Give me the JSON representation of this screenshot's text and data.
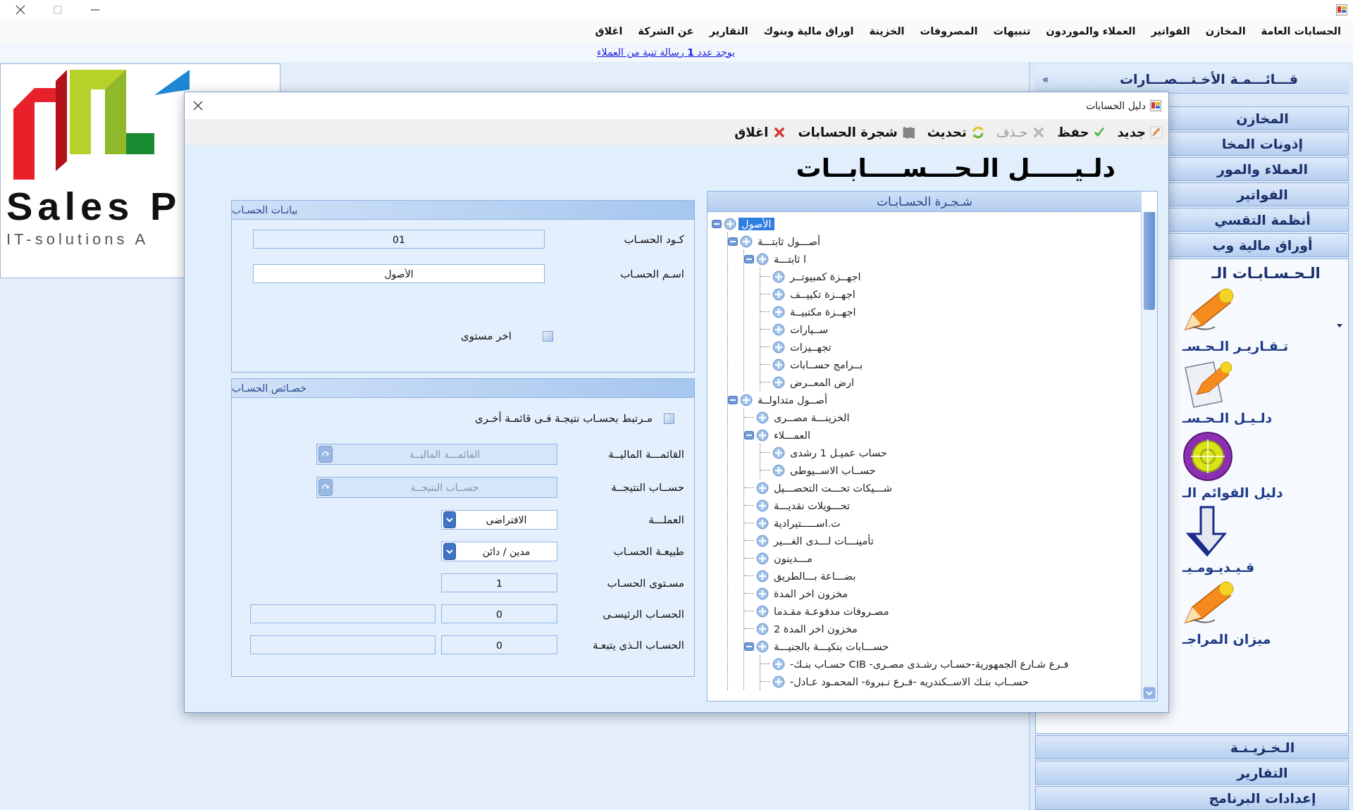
{
  "menu": [
    {
      "label": "الحسابات العامة"
    },
    {
      "label": "المخازن"
    },
    {
      "label": "الفواتير"
    },
    {
      "label": "العملاء والموردون"
    },
    {
      "label": "تنبيهات"
    },
    {
      "label": "المصروفات"
    },
    {
      "label": "الخزينة"
    },
    {
      "label": "اوراق مالية وبنوك"
    },
    {
      "label": "التقارير"
    },
    {
      "label": "عن الشركة"
    },
    {
      "label": "اغلاق"
    }
  ],
  "notice": "يوجد عدد  **1**  رسالة تنبة من العملاء",
  "logo": {
    "name": "Sales P",
    "tagline": "IT-solutions A"
  },
  "shortcuts": {
    "title": "قـــائـــمـة الأخـتـــصـــارات",
    "collapse": "»",
    "groups_top": [
      {
        "label": "المخازن"
      },
      {
        "label": "إذونات المخا"
      },
      {
        "label": "العملاء والمور"
      },
      {
        "label": "الفواتير"
      },
      {
        "label": "أنظمة التقسي"
      },
      {
        "label": "أوراق مالية وب"
      }
    ],
    "open_group": {
      "title": "الـحـسـابـات الـ",
      "items": [
        {
          "kind": "pencil",
          "label": "تـقـاريـر الـحـسـ"
        },
        {
          "kind": "document",
          "label": "دلـيـل الـحـسـ"
        },
        {
          "kind": "target",
          "label": "دليل القوائم الـ"
        },
        {
          "kind": "arrow",
          "label": "قـيـديـومـيـ"
        },
        {
          "kind": "pencil",
          "label": "ميزان المراجـ"
        }
      ]
    },
    "groups_bottom": [
      {
        "label": "الـخـزيـنـة"
      },
      {
        "label": "التقارير"
      },
      {
        "label": "إعدادات البرنامج"
      }
    ]
  },
  "dialog": {
    "title": "دليل الحسابات",
    "toolbar": [
      {
        "kind": "new",
        "label": "جديد",
        "disabled": false
      },
      {
        "kind": "save",
        "label": "حفظ",
        "disabled": false
      },
      {
        "kind": "delete",
        "label": "حـذف",
        "disabled": true
      },
      {
        "kind": "refresh",
        "label": "تحديث",
        "disabled": false
      },
      {
        "kind": "tree",
        "label": "شجرة الحسابات",
        "disabled": false
      },
      {
        "kind": "close",
        "label": "اغلاق",
        "disabled": false
      }
    ],
    "heading": "دلـيـــــل الـحـــســــابــات",
    "tree": {
      "title": "شـجـرة الحسـابـات",
      "nodes": [
        {
          "label": "الأصول",
          "selected": true,
          "expanded": true,
          "children": [
            {
              "label": "أصـــول ثابتـــة",
              "selected": false,
              "expanded": true,
              "children": [
                {
                  "label": "ا ثابتـــة",
                  "selected": false,
                  "expanded": true,
                  "children": [
                    {
                      "label": "اجهــزة كمبيوتــر",
                      "selected": false
                    },
                    {
                      "label": "اجهــزة تكييــف",
                      "selected": false
                    },
                    {
                      "label": "اجهــزة مكتبيــة",
                      "selected": false
                    },
                    {
                      "label": "ســيارات",
                      "selected": false
                    },
                    {
                      "label": "تجهــيزات",
                      "selected": false
                    },
                    {
                      "label": "بــرامج حســابات",
                      "selected": false
                    },
                    {
                      "label": "ارض المعــرض",
                      "selected": false
                    }
                  ]
                }
              ]
            },
            {
              "label": "أصــول متداولــة",
              "selected": false,
              "expanded": true,
              "children": [
                {
                  "label": "الخزينـــة مصــرى",
                  "selected": false
                },
                {
                  "label": "العمـــلاء",
                  "selected": false,
                  "expanded": true,
                  "children": [
                    {
                      "label": "حساب عميـل 1 رشدى",
                      "selected": false
                    },
                    {
                      "label": "حســاب الاســيوطى",
                      "selected": false
                    }
                  ]
                },
                {
                  "label": "شـــيكات تحـــت التحصـــيل",
                  "selected": false
                },
                {
                  "label": "تحـــويلات نقديـــة",
                  "selected": false
                },
                {
                  "label": "ت.اســـــتيرادية",
                  "selected": false
                },
                {
                  "label": "تأمينـــات لـــدى الغـــير",
                  "selected": false
                },
                {
                  "label": "مـــدينون",
                  "selected": false
                },
                {
                  "label": "بضـــاعة بـــالطريق",
                  "selected": false
                },
                {
                  "label": "مخزون اخر المدة",
                  "selected": false
                },
                {
                  "label": "مصـروفات مدفوعـة مقـدما",
                  "selected": false
                },
                {
                  "label": "مخزون اخر المدة 2",
                  "selected": false
                },
                {
                  "label": "حســـابات بنكيـــة بالجنيـــة",
                  "selected": false,
                  "expanded": true,
                  "children": [
                    {
                      "label": "فـرع شـارع الجمهورية-حسـاب رشـدى مصـرى- CIB حسـاب بنـك-",
                      "selected": false
                    },
                    {
                      "label": "حســاب بنـك الاســكندريه -فـرع نـبروة- المحمـود عـادل-",
                      "selected": false
                    }
                  ]
                }
              ]
            }
          ]
        }
      ]
    },
    "account_data": {
      "title": "بيانـات الحسـاب",
      "fields": [
        {
          "label": "كـود الحسـاب",
          "value": "01",
          "readonly": true
        },
        {
          "label": "اسـم الحسـاب",
          "value": "الأصول",
          "readonly": false
        }
      ],
      "last_level": {
        "label": "اخر مستوى",
        "checked": false
      }
    },
    "account_properties": {
      "title": "خصـائص الحسـاب",
      "linked": {
        "label": "مـرتبط بحسـاب نتيجـة فـى قائمـة أخـرى",
        "checked": false
      },
      "fields": [
        {
          "kind": "lookup",
          "label": "القائمـــة الماليــة",
          "placeholder": "القائمـــة الماليــة",
          "disabled": true
        },
        {
          "kind": "lookup",
          "label": "حســاب النتيجــة",
          "placeholder": "حســاب النتيجــة",
          "disabled": true
        },
        {
          "kind": "dropdown",
          "label": "العملـــة",
          "value": "الافتراضى"
        },
        {
          "kind": "dropdown",
          "label": "طبيعـة الحسـاب",
          "value": "مدين / دائن"
        },
        {
          "kind": "text",
          "label": "مسـتوى الحسـاب",
          "value": "1"
        },
        {
          "kind": "pair",
          "label": "الحسـاب الرئيسـى",
          "value": "0"
        },
        {
          "kind": "pair",
          "label": "الحسـاب الـذى يتبعـة",
          "value": "0"
        }
      ]
    }
  }
}
